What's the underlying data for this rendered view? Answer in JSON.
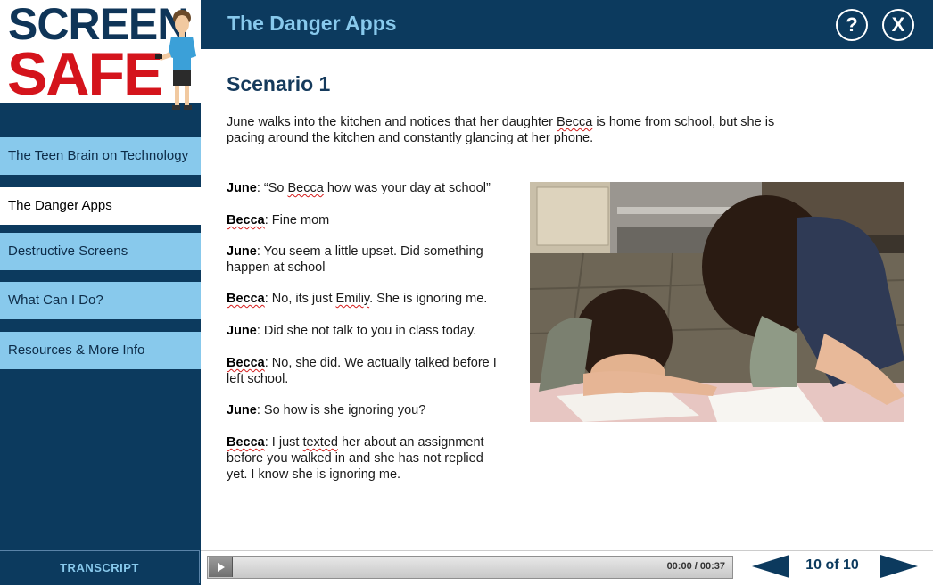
{
  "logo": {
    "line1": "SCREEN",
    "line2": "SAFE"
  },
  "header": {
    "title": "The Danger Apps",
    "help_label": "?",
    "close_label": "X"
  },
  "sidebar": {
    "items": [
      {
        "label": "The Teen Brain on Technology",
        "active": false
      },
      {
        "label": "The Danger Apps",
        "active": true
      },
      {
        "label": "Destructive Screens",
        "active": false
      },
      {
        "label": "What Can I Do?",
        "active": false
      },
      {
        "label": "Resources & More Info",
        "active": false
      }
    ],
    "transcript_label": "TRANSCRIPT"
  },
  "scenario": {
    "title": "Scenario 1",
    "intro_1": "June walks into the kitchen and notices that her daughter ",
    "intro_name": "Becca",
    "intro_2": " is home from school, but she is pacing around the kitchen and constantly glancing at her phone.",
    "dialogue": [
      {
        "speaker": "June",
        "parts": [
          ": “So ",
          "Becca",
          " how was your day at school”"
        ]
      },
      {
        "speaker": "Becca",
        "parts": [
          ": Fine mom"
        ]
      },
      {
        "speaker": "June",
        "parts": [
          ": You seem a little upset. Did something happen at school"
        ]
      },
      {
        "speaker": "Becca",
        "parts": [
          ": No, its just ",
          "Emiliy",
          ". She is ignoring me."
        ]
      },
      {
        "speaker": "June",
        "parts": [
          ": Did she not talk to you in class today."
        ]
      },
      {
        "speaker": "Becca",
        "parts": [
          ": No, she did. We actually talked before I left school."
        ]
      },
      {
        "speaker": "June",
        "parts": [
          ": So how is she ignoring you?"
        ]
      },
      {
        "speaker": "Becca",
        "parts": [
          ": I just ",
          "texted",
          " her about an assignment before you walked in and she has not replied yet. I know she is ignoring me."
        ]
      }
    ]
  },
  "player": {
    "time": "00:00 / 00:37"
  },
  "pagination": {
    "counter": "10 of 10"
  },
  "colors": {
    "navy": "#0c3a5e",
    "light_blue": "#88c9ec",
    "brand_red": "#d4141c"
  }
}
